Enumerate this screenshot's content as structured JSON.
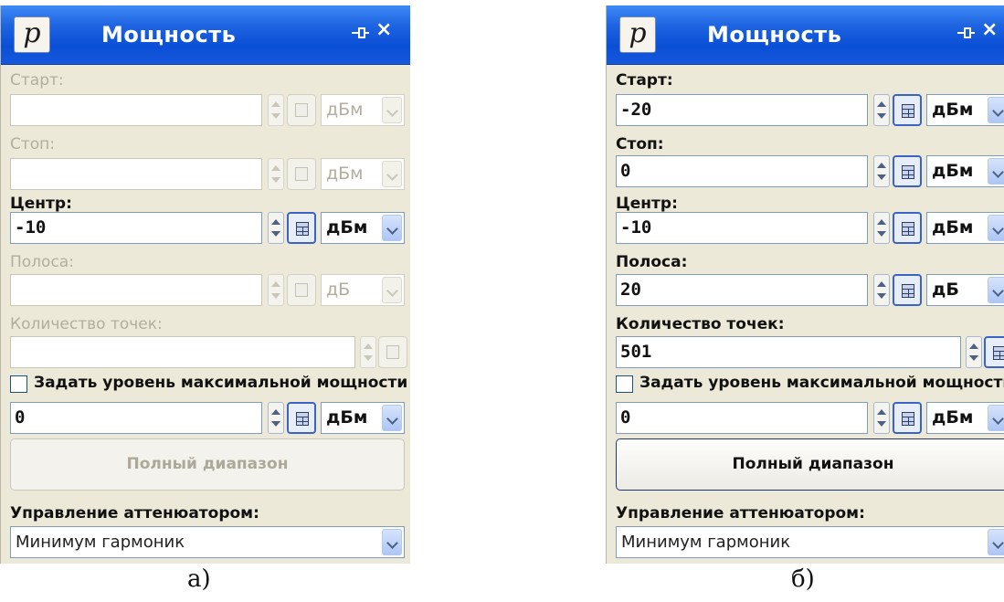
{
  "title": "Мощность",
  "logo_letter": "p",
  "close_glyph": "×",
  "captions": {
    "a": "а)",
    "b": "б)"
  },
  "panel_a": {
    "start_label": "Старт:",
    "start_value": "",
    "start_unit": "дБм",
    "stop_label": "Стоп:",
    "stop_value": "",
    "stop_unit": "дБм",
    "center_label": "Центр:",
    "center_value": "-10",
    "center_unit": "дБм",
    "span_label": "Полоса:",
    "span_value": "",
    "span_unit": "дБ",
    "points_label": "Количество точек:",
    "points_value": "",
    "max_power_checkbox_label": "Задать уровень максимальной мощности",
    "max_power_value": "0",
    "max_power_unit": "дБм",
    "full_range_button": "Полный диапазон",
    "attenuator_label": "Управление аттенюатором:",
    "attenuator_value": "Минимум гармоник"
  },
  "panel_b": {
    "start_label": "Старт:",
    "start_value": "-20",
    "start_unit": "дБм",
    "stop_label": "Стоп:",
    "stop_value": "0",
    "stop_unit": "дБм",
    "center_label": "Центр:",
    "center_value": "-10",
    "center_unit": "дБм",
    "span_label": "Полоса:",
    "span_value": "20",
    "span_unit": "дБ",
    "points_label": "Количество точек:",
    "points_value": "501",
    "max_power_checkbox_label": "Задать уровень максимальной мощности",
    "max_power_value": "0",
    "max_power_unit": "дБм",
    "full_range_button": "Полный диапазон",
    "attenuator_label": "Управление аттенюатором:",
    "attenuator_value": "Минимум гармоник"
  },
  "colors": {
    "titlebar": "#0a4fd6",
    "panel_bg": "#ece9d8",
    "disabled_text": "#b1ae9f"
  },
  "icons": [
    "pin-icon",
    "close-icon",
    "calculator-icon",
    "spin-arrows-icon",
    "dropdown-arrow-icon"
  ]
}
